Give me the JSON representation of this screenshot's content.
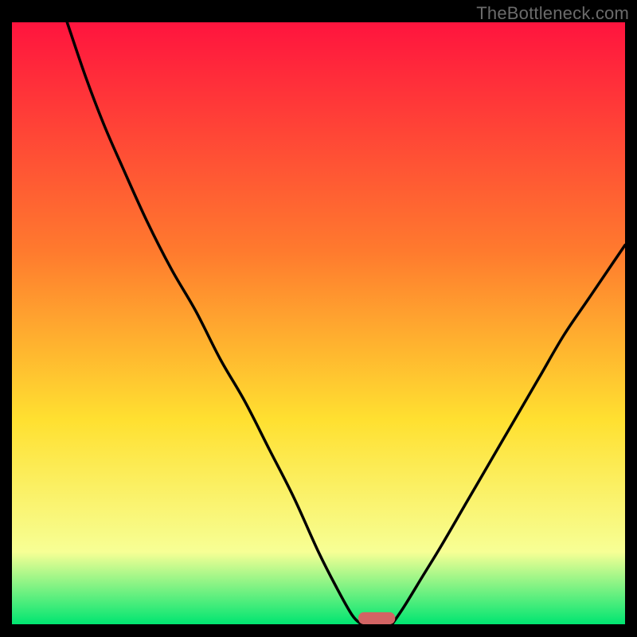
{
  "watermark": "TheBottleneck.com",
  "colors": {
    "background": "#000000",
    "gradient_top": "#ff143e",
    "gradient_mid1": "#ff7a2e",
    "gradient_mid2": "#ffe030",
    "gradient_mid3": "#f7ff95",
    "gradient_bottom": "#00e571",
    "curve": "#000000",
    "marker": "#d36464"
  },
  "chart_data": {
    "type": "line",
    "title": "",
    "xlabel": "",
    "ylabel": "",
    "xlim": [
      0,
      100
    ],
    "ylim": [
      0,
      100
    ],
    "series": [
      {
        "name": "left-curve",
        "x": [
          9,
          12,
          15,
          18,
          22,
          26,
          30,
          34,
          38,
          42,
          46,
          50,
          53,
          55.5,
          57
        ],
        "y": [
          100,
          91,
          83,
          76,
          67,
          59,
          52,
          44,
          37,
          29,
          21,
          12,
          6,
          1.5,
          0
        ]
      },
      {
        "name": "right-curve",
        "x": [
          62,
          64,
          67,
          70,
          74,
          78,
          82,
          86,
          90,
          94,
          98,
          100
        ],
        "y": [
          0,
          3,
          8,
          13,
          20,
          27,
          34,
          41,
          48,
          54,
          60,
          63
        ]
      }
    ],
    "marker": {
      "x_center": 59.5,
      "width": 6,
      "height": 2.0
    }
  }
}
